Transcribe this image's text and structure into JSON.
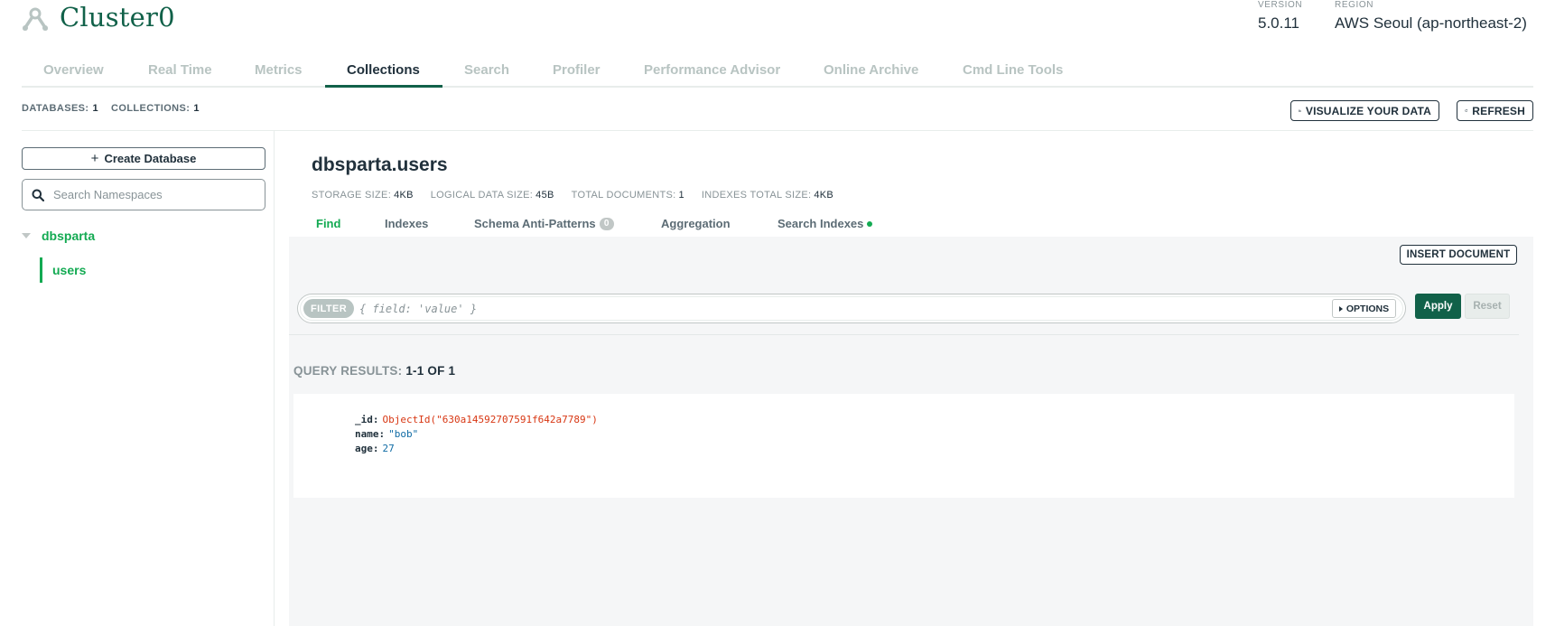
{
  "header": {
    "cluster_name": "Cluster0",
    "version_label": "VERSION",
    "version_value": "5.0.11",
    "region_label": "REGION",
    "region_value": "AWS Seoul (ap-northeast-2)"
  },
  "nav": {
    "tabs": [
      "Overview",
      "Real Time",
      "Metrics",
      "Collections",
      "Search",
      "Profiler",
      "Performance Advisor",
      "Online Archive",
      "Cmd Line Tools"
    ],
    "active": "Collections"
  },
  "summary": {
    "databases_label": "DATABASES:",
    "databases_value": "1",
    "collections_label": "COLLECTIONS:",
    "collections_value": "1",
    "visualize_label": "VISUALIZE YOUR DATA",
    "refresh_label": "REFRESH"
  },
  "sidebar": {
    "create_label": "Create Database",
    "search_placeholder": "Search Namespaces",
    "database": "dbsparta",
    "collection": "users"
  },
  "namespace": {
    "title": "dbsparta.users",
    "stats": [
      {
        "label": "STORAGE SIZE:",
        "value": "4KB"
      },
      {
        "label": "LOGICAL DATA SIZE:",
        "value": "45B"
      },
      {
        "label": "TOTAL DOCUMENTS:",
        "value": "1"
      },
      {
        "label": "INDEXES TOTAL SIZE:",
        "value": "4KB"
      }
    ]
  },
  "subtabs": {
    "find": "Find",
    "indexes": "Indexes",
    "schema": "Schema Anti-Patterns",
    "schema_badge": "0",
    "aggregation": "Aggregation",
    "search_indexes": "Search Indexes"
  },
  "query": {
    "insert_label": "INSERT DOCUMENT",
    "filter_label": "FILTER",
    "filter_placeholder": "{ field: 'value' }",
    "options_label": "OPTIONS",
    "apply_label": "Apply",
    "reset_label": "Reset",
    "results_label": "QUERY RESULTS:",
    "results_value": "1-1 OF 1"
  },
  "document": {
    "fields": [
      {
        "key": "_id:",
        "value": "ObjectId(\"630a14592707591f642a7789\")"
      },
      {
        "key": "name:",
        "value": "\"bob\""
      },
      {
        "key": "age:",
        "value": "27"
      }
    ]
  },
  "colors": {
    "brand_dark": "#116149",
    "brand_green": "#13aa52",
    "object_id": "#d83713",
    "value_blue": "#116ca5"
  }
}
